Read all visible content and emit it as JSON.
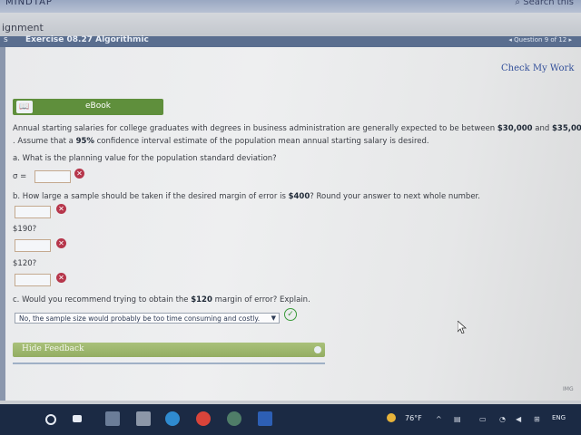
{
  "browser": {
    "app_name": "MINDTAP",
    "search_label": "Search this"
  },
  "header": {
    "assignment_label": "ignment",
    "section_letter": "s",
    "exercise_title": "Exercise 08.27 Algorithmic",
    "question_nav": "◂ Question 9 of 12 ▸"
  },
  "actions": {
    "check_my_work": "Check My Work",
    "ebook": "eBook"
  },
  "problem": {
    "intro_line1_pre": "Annual starting salaries for college graduates with degrees in business administration are generally expected to be between ",
    "low": "$30,000",
    "and": " and ",
    "high": "$35,000",
    "intro_line2_pre": ". Assume that a ",
    "confidence": "95%",
    "intro_line2_post": " confidence interval estimate of the population mean annual starting salary is desired.",
    "part_a": "a. What is the planning value for the population standard deviation?",
    "sigma": "σ =",
    "part_b_pre": "b. How large a sample should be taken if the desired margin of error is ",
    "margin_b": "$400",
    "part_b_post": "? Round your answer to next whole number.",
    "margin_190": "$190?",
    "margin_120": "$120?",
    "part_c_pre": "c. Would you recommend trying to obtain the ",
    "margin_c": "$120",
    "part_c_post": " margin of error? Explain.",
    "answer_c": "No, the sample size would probably be too time consuming and costly."
  },
  "feedback": {
    "hide_label": "Hide Feedback"
  },
  "footer": {
    "img_label": "IMG"
  },
  "taskbar": {
    "weather": "76°F",
    "language": "ENG"
  },
  "colors": {
    "ebook_green": "#5f8f3c",
    "error_red": "#b6364b",
    "correct_green": "#3a9a3a",
    "taskbar": "#1b2a44"
  }
}
